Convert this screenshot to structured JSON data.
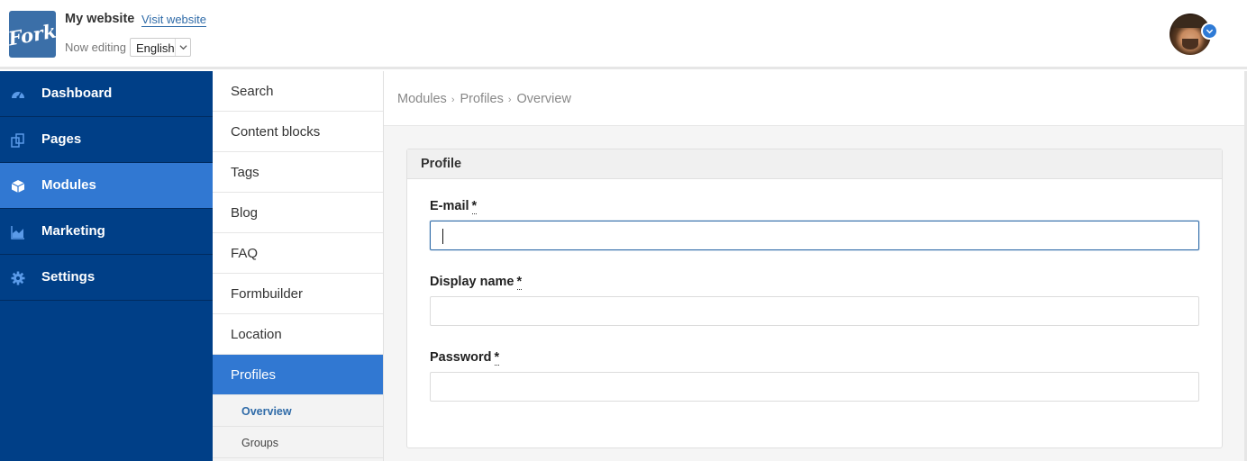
{
  "header": {
    "logo_text": "Fork",
    "site_title": "My website",
    "visit_link": "Visit website",
    "now_editing_label": "Now editing",
    "language": "English"
  },
  "main_nav": {
    "items": [
      {
        "label": "Dashboard",
        "icon": "dashboard-icon",
        "active": false
      },
      {
        "label": "Pages",
        "icon": "pages-icon",
        "active": false
      },
      {
        "label": "Modules",
        "icon": "cube-icon",
        "active": true
      },
      {
        "label": "Marketing",
        "icon": "area-chart-icon",
        "active": false
      },
      {
        "label": "Settings",
        "icon": "gear-icon",
        "active": false
      }
    ]
  },
  "sub_nav": {
    "items": [
      {
        "label": "Search"
      },
      {
        "label": "Content blocks"
      },
      {
        "label": "Tags"
      },
      {
        "label": "Blog"
      },
      {
        "label": "FAQ"
      },
      {
        "label": "Formbuilder"
      },
      {
        "label": "Location"
      },
      {
        "label": "Profiles",
        "active": true
      }
    ],
    "children": [
      {
        "label": "Overview",
        "active": true
      },
      {
        "label": "Groups"
      }
    ]
  },
  "breadcrumb": [
    "Modules",
    "Profiles",
    "Overview"
  ],
  "breadcrumb_separator": "›",
  "form": {
    "panel_title": "Profile",
    "required_mark": "*",
    "fields": [
      {
        "label": "E-mail",
        "value": ""
      },
      {
        "label": "Display name",
        "value": ""
      },
      {
        "label": "Password",
        "value": ""
      }
    ]
  },
  "colors": {
    "nav_bg": "#003f87",
    "accent": "#3178d2",
    "link": "#2f6ba8"
  }
}
